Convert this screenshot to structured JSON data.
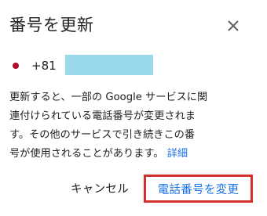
{
  "dialog": {
    "title": "番号を更新",
    "close_icon": "close-icon",
    "phone": {
      "country_code": "+81",
      "flag_color": "#ae0a2e",
      "mask_color": "#9bd9ec"
    },
    "body_lines": [
      "更新すると、一部の Google サービスに関",
      "連付けられている電話番号が変更されま",
      "す。その他のサービスで引き続きこの番",
      "号が使用されることがあります。"
    ],
    "more_link": "詳細",
    "cancel_label": "キャンセル",
    "change_label": "電話番号を変更",
    "accent_color": "#1a73e8",
    "highlight_color": "#d32f2f"
  }
}
